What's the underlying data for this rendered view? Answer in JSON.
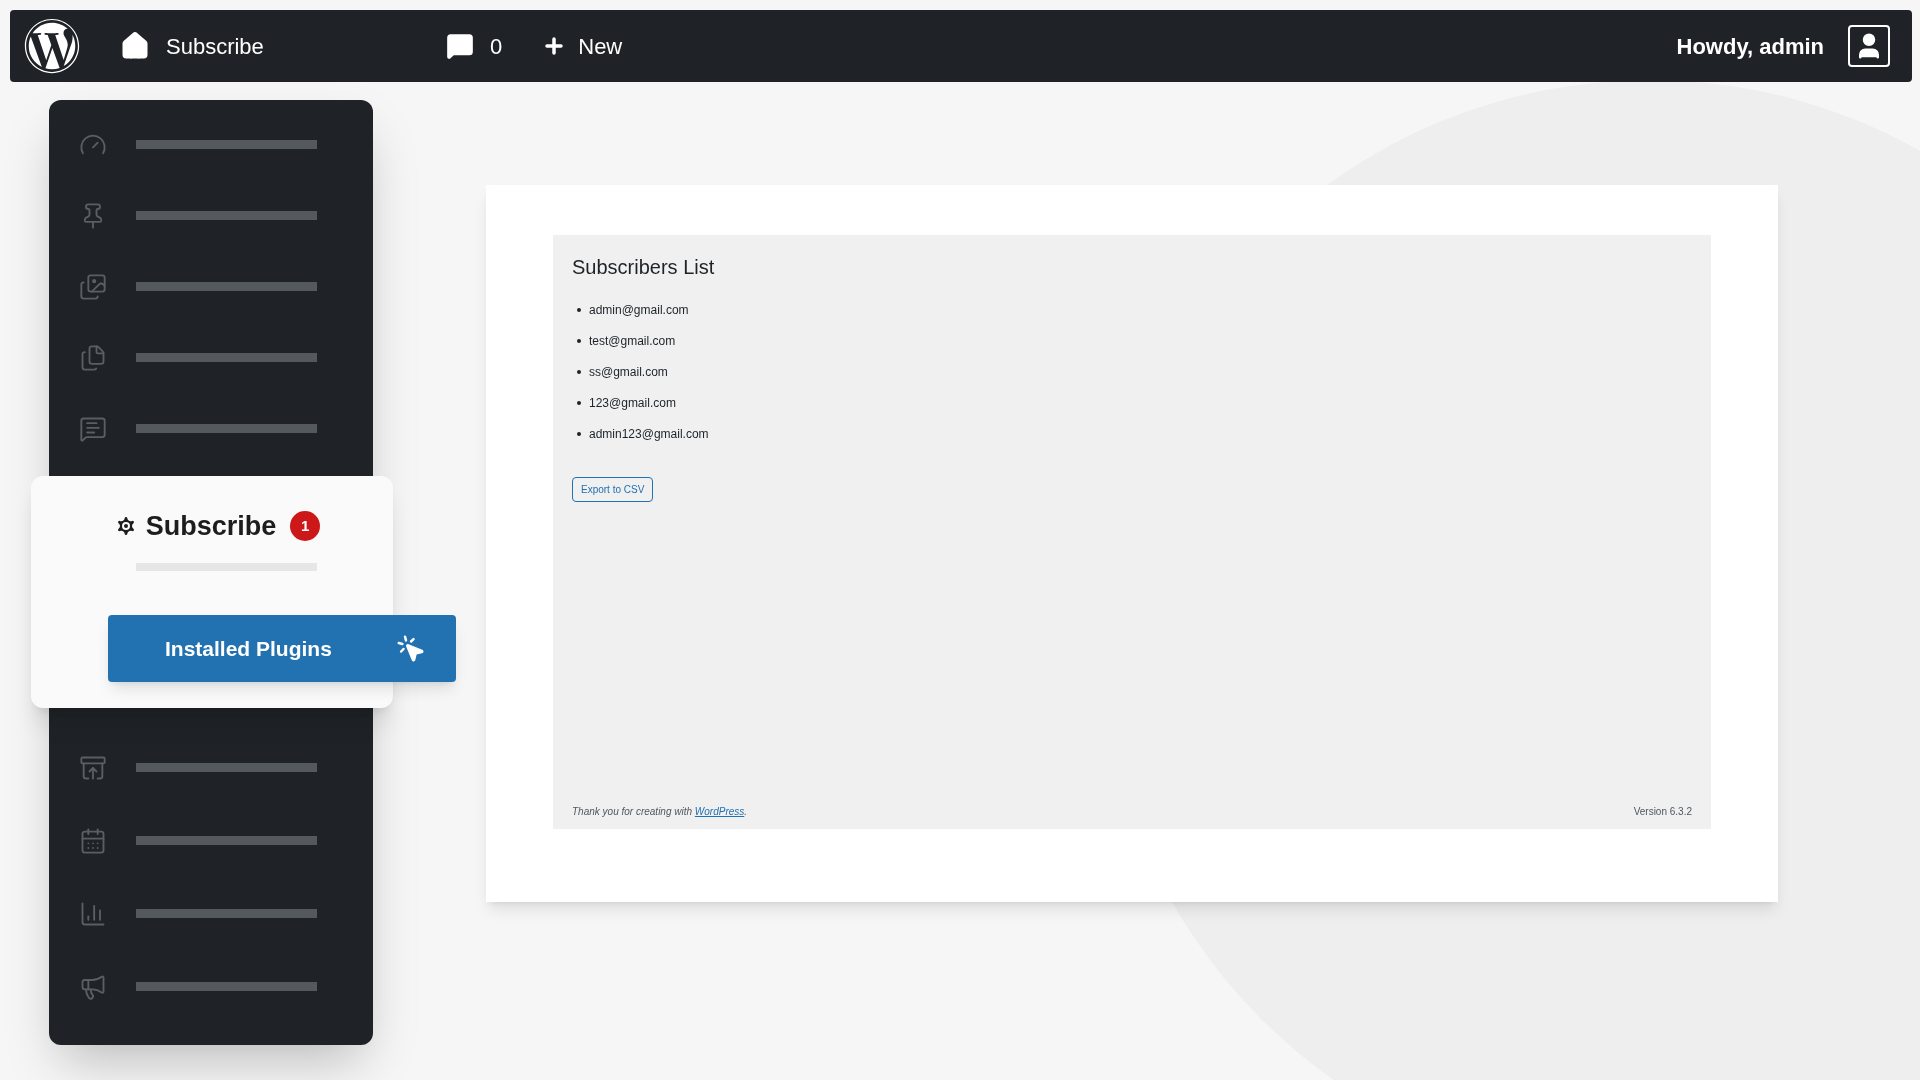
{
  "admin_bar": {
    "site_name": "Subscribe",
    "comments_count": "0",
    "new_label": "New",
    "greeting": "Howdy, admin"
  },
  "menu_popup": {
    "title": "Subscribe",
    "badge": "1",
    "submenu_button": "Installed Plugins"
  },
  "content": {
    "title": "Subscribers List",
    "subscribers": [
      "admin@gmail.com",
      "test@gmail.com",
      "ss@gmail.com",
      "123@gmail.com",
      "admin123@gmail.com"
    ],
    "export_button": "Export to CSV",
    "footer": {
      "before": "Thank you for creating with ",
      "link": "WordPress",
      "after": "."
    },
    "version": "Version 6.3.2"
  }
}
